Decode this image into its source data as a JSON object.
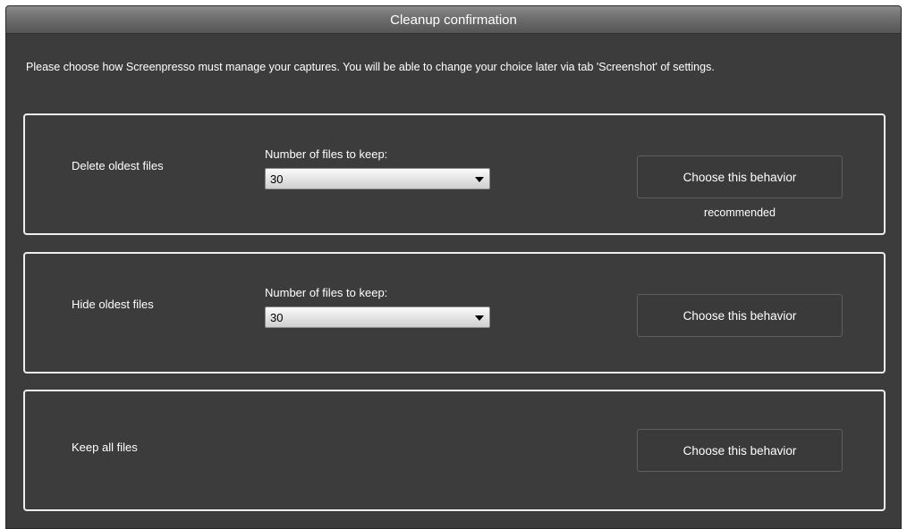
{
  "window": {
    "title": "Cleanup confirmation"
  },
  "intro_text": "Please choose how Screenpresso must manage your captures. You will be able to change your choice later via tab 'Screenshot' of settings.",
  "options": [
    {
      "label": "Delete oldest files",
      "keep_label": "Number of files to keep:",
      "keep_value": "30",
      "button_label": "Choose this behavior",
      "note": "recommended"
    },
    {
      "label": "Hide oldest files",
      "keep_label": "Number of files to keep:",
      "keep_value": "30",
      "button_label": "Choose this behavior"
    },
    {
      "label": "Keep all files",
      "button_label": "Choose this behavior"
    }
  ],
  "colors": {
    "background": "#3c3c3c",
    "text": "#ffffff",
    "border": "#eeeeee"
  }
}
